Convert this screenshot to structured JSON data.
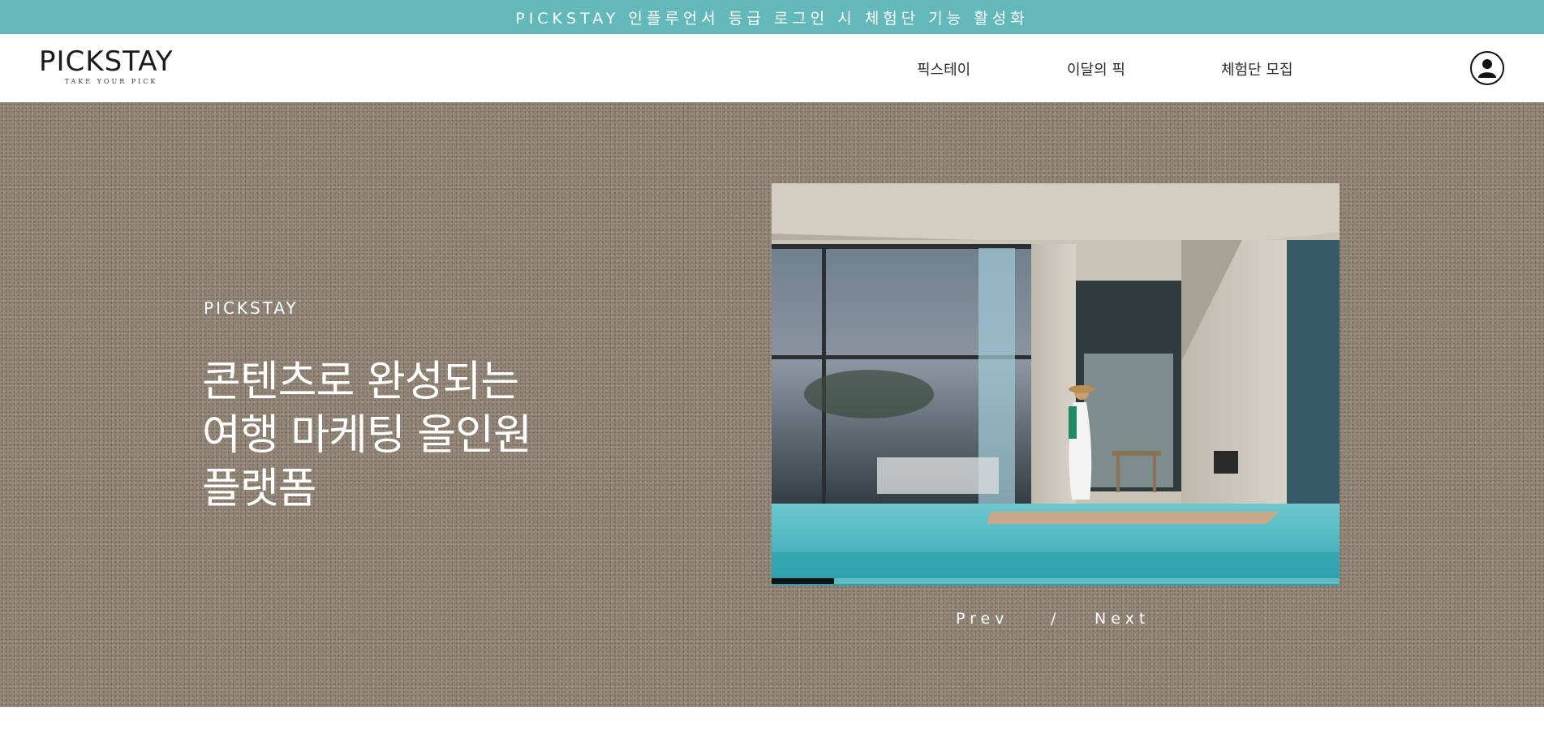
{
  "announcement": {
    "text": "PICKSTAY 인플루언서 등급 로그인 시 체험단 기능 활성화",
    "background": "#63b8b9"
  },
  "header": {
    "logo": {
      "word": "PICKSTAY",
      "tagline": "TAKE YOUR PICK"
    },
    "nav": [
      {
        "label": "픽스테이"
      },
      {
        "label": "이달의 픽"
      },
      {
        "label": "체험단 모집"
      }
    ],
    "user_icon": "user-circle-icon"
  },
  "hero": {
    "eyebrow": "PICKSTAY",
    "title_lines": [
      "콘텐츠로 완성되는",
      "여행 마케팅 올인원",
      "플랫폼"
    ],
    "background": "#978b7e",
    "slider": {
      "image_icon": "villa-pool-photo",
      "progress": 0.11,
      "prev_label": "Prev",
      "separator": "/",
      "next_label": "Next"
    }
  }
}
